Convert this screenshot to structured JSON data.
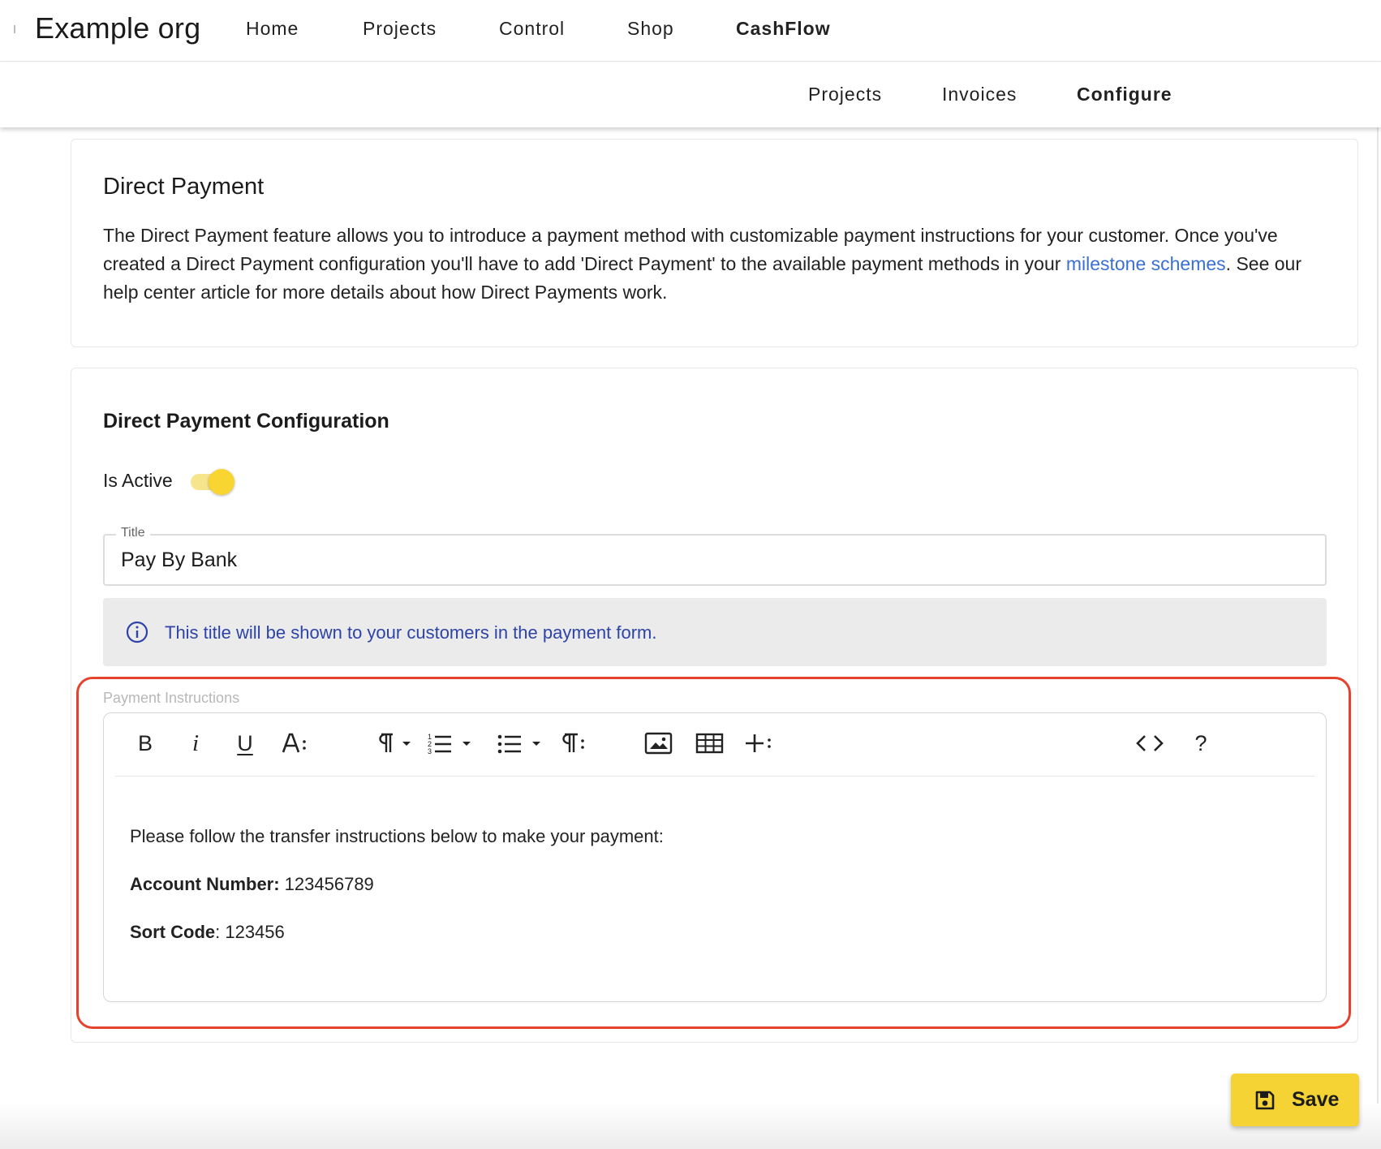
{
  "header": {
    "brand": "Example org",
    "nav": [
      "Home",
      "Projects",
      "Control",
      "Shop",
      "CashFlow"
    ],
    "active_nav": "CashFlow"
  },
  "subnav": {
    "items": [
      "Projects",
      "Invoices",
      "Configure"
    ],
    "active": "Configure"
  },
  "intro": {
    "title": "Direct Payment",
    "text_before_link": "The Direct Payment feature allows you to introduce a payment method with customizable payment instructions for your customer. Once you've created a Direct Payment configuration you'll have to add 'Direct Payment' to the available payment methods in your ",
    "link_text": "milestone schemes",
    "text_after_link": ". See our help center article for more details about how Direct Payments work."
  },
  "config": {
    "title": "Direct Payment Configuration",
    "is_active_label": "Is Active",
    "is_active": true,
    "title_field_label": "Title",
    "title_field_value": "Pay By Bank",
    "info_text": "This title will be shown to your customers in the payment form.",
    "instructions_label": "Payment Instructions",
    "toolbar_icons": [
      "bold-icon",
      "italic-icon",
      "underline-icon",
      "font-size-icon",
      "paragraph-format-icon",
      "ordered-list-icon",
      "unordered-list-icon",
      "paragraph-style-icon",
      "image-icon",
      "table-icon",
      "insert-more-icon",
      "code-view-icon",
      "help-icon"
    ],
    "toolbar_glyphs": {
      "bold": "B",
      "italic": "i",
      "underline": "U",
      "help": "?"
    },
    "instructions": {
      "line1": "Please follow the transfer instructions below to make your payment:",
      "account_label": "Account Number:",
      "account_value": " 123456789",
      "sort_label": "Sort Code",
      "sort_value": ": 123456"
    }
  },
  "actions": {
    "save_label": "Save"
  },
  "colors": {
    "accent": "#f5d335",
    "link": "#3b6fd4",
    "info_text": "#2d43a8",
    "highlight_border": "#e4432e"
  }
}
